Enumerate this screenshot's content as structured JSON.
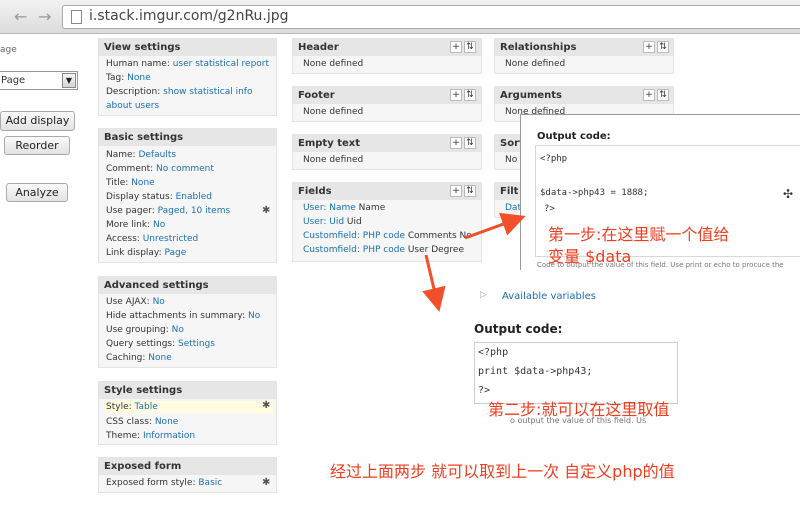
{
  "browser": {
    "url": "i.stack.imgur.com/g2nRu.jpg",
    "back_icon": "arrow-left-icon",
    "forward_icon": "arrow-right-icon",
    "page_icon": "page-icon"
  },
  "left": {
    "partial_label": "age",
    "select_value": "Page",
    "add_display": "Add display",
    "reorder": "Reorder",
    "analyze": "Analyze"
  },
  "col1": {
    "view": {
      "title": "View settings",
      "human_label": "Human name:",
      "human_value": "user statistical report",
      "tag_label": "Tag:",
      "tag_value": "None",
      "desc_label": "Description:",
      "desc_value1": "show statistical info",
      "desc_value2": "about users"
    },
    "basic": {
      "title": "Basic settings",
      "rows": [
        {
          "label": "Name:",
          "value": "Defaults"
        },
        {
          "label": "Comment:",
          "value": "No comment"
        },
        {
          "label": "Title:",
          "value": "None"
        },
        {
          "label": "Display status:",
          "value": "Enabled"
        },
        {
          "label": "Use pager:",
          "value": "Paged, 10 items"
        },
        {
          "label": "More link:",
          "value": "No"
        },
        {
          "label": "Access:",
          "value": "Unrestricted"
        },
        {
          "label": "Link display:",
          "value": "Page"
        }
      ]
    },
    "advanced": {
      "title": "Advanced settings",
      "rows": [
        {
          "label": "Use AJAX:",
          "value": "No"
        },
        {
          "label": "Hide attachments in summary:",
          "value": "No"
        },
        {
          "label": "Use grouping:",
          "value": "No"
        },
        {
          "label": "Query settings:",
          "value": "Settings"
        },
        {
          "label": "Caching:",
          "value": "None"
        }
      ]
    },
    "style": {
      "title": "Style settings",
      "rows": [
        {
          "label": "Style:",
          "value": "Table"
        },
        {
          "label": "CSS class:",
          "value": "None"
        },
        {
          "label": "Theme:",
          "value": "Information"
        }
      ]
    },
    "exposed": {
      "title": "Exposed form",
      "row_label": "Exposed form style:",
      "row_value": "Basic"
    }
  },
  "col2": {
    "header": {
      "title": "Header",
      "body": "None defined"
    },
    "footer": {
      "title": "Footer",
      "body": "None defined"
    },
    "empty": {
      "title": "Empty text",
      "body": "None defined"
    },
    "fields": {
      "title": "Fields",
      "rows": [
        {
          "link": "User: Name",
          "text": " Name"
        },
        {
          "link": "User: Uid",
          "text": " Uid"
        },
        {
          "link": "Customfield: PHP code",
          "text": " Comments No"
        },
        {
          "link": "Customfield: PHP code",
          "text": " User Degree"
        }
      ]
    }
  },
  "col3": {
    "relationships": {
      "title": "Relationships",
      "body": "None defined"
    },
    "arguments": {
      "title": "Arguments",
      "body": "None defined"
    },
    "sort_partial": "Sort",
    "sort_body_partial": "No",
    "filter_partial": "Filt",
    "filter_body_partial": "Dat"
  },
  "pm_symbols": {
    "plus": "+",
    "sort": "⇅"
  },
  "overlay1": {
    "title": "Output code:",
    "line1": "<?php",
    "line2": "$data->php43 = 1888;",
    "line3": "?>",
    "desc": "Code to output the value of this field. Use print or echo to procuce the"
  },
  "overlay2": {
    "available": "Available variables",
    "title": "Output code:",
    "line1": "<?php",
    "line2": "print $data->php43;",
    "line3": "?>",
    "desc": "o output the value of this field. Us"
  },
  "annotations": {
    "step1_line1": "第一步:在这里赋一个值给",
    "step1_line2": "变量 $data",
    "step2": "第二步:就可以在这里取值",
    "summary": "经过上面两步 就可以取到上一次 自定义php的值"
  },
  "colors": {
    "link": "#1a6fb5",
    "annotation": "#f23c1e",
    "arrow": "#f2502a"
  }
}
